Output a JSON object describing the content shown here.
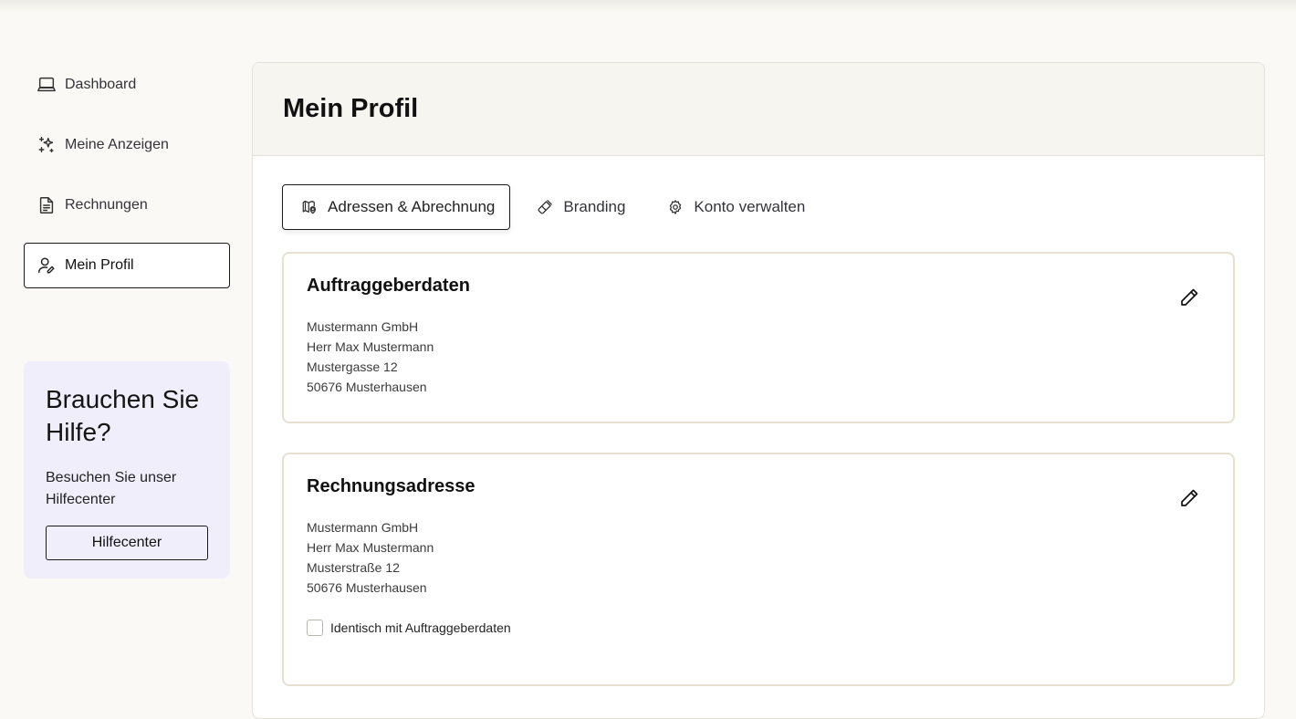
{
  "sidebar": {
    "items": [
      {
        "label": "Dashboard",
        "icon": "laptop-icon"
      },
      {
        "label": "Meine Anzeigen",
        "icon": "sparkles-icon"
      },
      {
        "label": "Rechnungen",
        "icon": "document-icon"
      },
      {
        "label": "Mein Profil",
        "icon": "user-edit-icon",
        "active": true
      }
    ]
  },
  "help": {
    "title": "Brauchen Sie Hilfe?",
    "text": "Besuchen Sie unser Hilfecenter",
    "button": "Hilfecenter"
  },
  "main": {
    "title": "Mein Profil",
    "tabs": [
      {
        "label": "Adressen & Abrechnung",
        "icon": "map-pin-icon",
        "active": true
      },
      {
        "label": "Branding",
        "icon": "brush-icon"
      },
      {
        "label": "Konto verwalten",
        "icon": "gear-icon"
      }
    ],
    "cards": [
      {
        "title": "Auftraggeberdaten",
        "lines": [
          "Mustermann GmbH",
          "Herr Max Mustermann",
          "Mustergasse 12",
          "50676 Musterhausen"
        ]
      },
      {
        "title": "Rechnungsadresse",
        "lines": [
          "Mustermann GmbH",
          "Herr Max Mustermann",
          "Musterstraße 12",
          "50676 Musterhausen"
        ],
        "checkbox_label": "Identisch mit Auftraggeberdaten",
        "checkbox_checked": false
      }
    ]
  }
}
